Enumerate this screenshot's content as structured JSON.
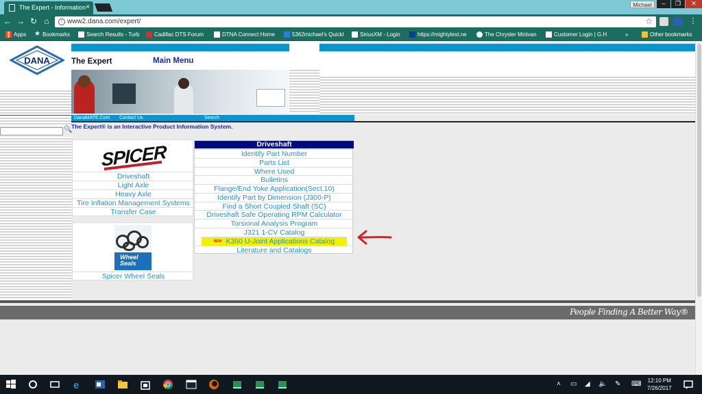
{
  "browser": {
    "tab_title": "The Expert - Information",
    "tab_close": "×",
    "profile_name": "Michael",
    "window_controls": {
      "minimize": "–",
      "maximize": "❐",
      "close": "✕"
    },
    "nav": {
      "back": "←",
      "forward": "→",
      "reload": "↻",
      "home": "⌂"
    },
    "url": "www2.dana.com/expert/",
    "bookmarks": [
      {
        "label": "Apps",
        "icon": "apps-grid-icon"
      },
      {
        "label": "Bookmarks",
        "icon": "star-icon"
      },
      {
        "label": "Search Results - Turb",
        "icon": "page-icon"
      },
      {
        "label": "Cadillac DTS Forum",
        "icon": "forum-icon"
      },
      {
        "label": "DTNA Connect Home",
        "icon": "truck-icon"
      },
      {
        "label": "5362michael's Quickl",
        "icon": "bookmark-icon"
      },
      {
        "label": "SiriusXM - Login",
        "icon": "siriusxm-icon"
      },
      {
        "label": "https://mightytext.ne",
        "icon": "mightytext-icon"
      },
      {
        "label": "The Chrysler Minivan",
        "icon": "chrysler-icon"
      },
      {
        "label": "Customer Login | G.H",
        "icon": "page-icon"
      }
    ],
    "overflow": "»",
    "other_bookmarks": "Other bookmarks"
  },
  "page": {
    "logo_text": "DANA",
    "site_title": "The Expert",
    "main_menu": "Main Menu",
    "subnav": [
      "DanaMATE.Com",
      "Contact Us",
      "Search"
    ],
    "tagline": "The Expert® is an Interactive Product Information System.",
    "spicer": {
      "logo_text": "SPICER",
      "links": [
        "Driveshaft",
        "Light Axle",
        "Heavy Axle",
        "Tire Inflation Management Systems",
        "Transfer Case"
      ]
    },
    "seals": {
      "image_label_line1": "Wheel",
      "image_label_line2": "Seals",
      "link": "Spicer Wheel Seals"
    },
    "driveshaft": {
      "header": "Driveshaft",
      "items": [
        "Identify Part Number",
        "Parts List",
        "Where Used",
        "Bulletins",
        "Flange/End Yoke Application(Sect.10)",
        "Identify Part by Dimension (J300-P)",
        "Find a Short Coupled Shaft (SC)",
        "Driveshaft Safe Operating RPM Calculator",
        "Torsional Analysis Program",
        "J321 1-CV Catalog"
      ],
      "new_badge": "NEW",
      "highlighted_item": "K350 U-Joint Applications Catalog",
      "last_item": "Literature and Catalogs"
    },
    "footer_slogan": "People Finding A Better Way®"
  },
  "taskbar": {
    "clock_time": "12:10 PM",
    "clock_date": "7/26/2017",
    "apps": [
      "start-icon",
      "cortana-icon",
      "task-view-icon",
      "edge-icon",
      "outlook-icon",
      "file-explorer-icon",
      "store-icon",
      "chrome-icon",
      "terminal-icon",
      "firefox-icon",
      "app-icon",
      "app-icon",
      "app-icon"
    ]
  },
  "colors": {
    "chrome_green": "#1b6e5f",
    "tab_strip": "#7ec9d6",
    "dana_blue": "#0d94cc",
    "menu_navy": "#000b80",
    "link_blue": "#2a8fd0",
    "highlight_yellow": "#f2f200",
    "annotation_red": "#d42020"
  }
}
